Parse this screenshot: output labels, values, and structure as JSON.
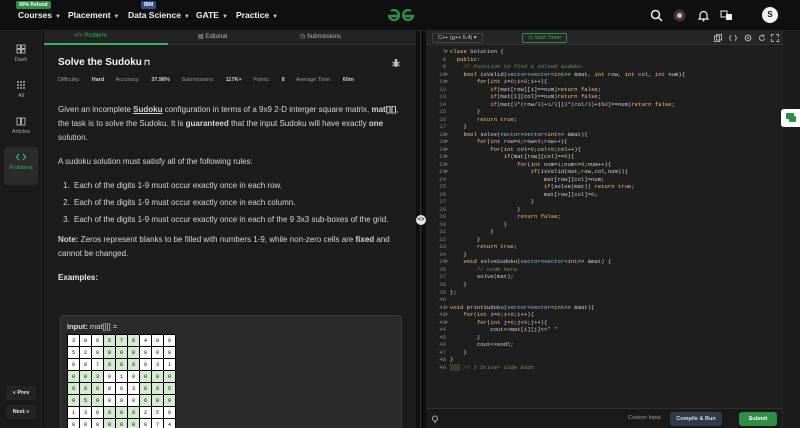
{
  "topbar": {
    "refund_badge": "90% Refund",
    "ibm_badge": "IBM",
    "nav": [
      "Courses",
      "Placement",
      "Data Science",
      "GATE",
      "Practice"
    ],
    "avatar_initial": "S",
    "brand_color": "#2f8d46"
  },
  "leftnav": {
    "items": [
      "Dash",
      "All",
      "Articles",
      "Problems"
    ],
    "prev": "« Prev",
    "next": "Next »"
  },
  "problem": {
    "tabs": [
      "Problem",
      "Editorial",
      "Submissions"
    ],
    "title": "Solve the Sudoku",
    "meta": {
      "difficulty_label": "Difficulty:",
      "difficulty": "Hard",
      "accuracy_label": "Accuracy:",
      "accuracy": "37.98%",
      "submissions_label": "Submissions:",
      "submissions": "117K+",
      "points_label": "Points:",
      "points": "8",
      "time_label": "Average Time:",
      "time": "60m"
    },
    "para1_a": "Given an incomplete ",
    "para1_link": "Sudoku",
    "para1_b": " configuration in terms of a 9x9  2-D interger square matrix, ",
    "para1_mat": "mat[][]",
    "para1_c": ", the task is to solve the Sudoku. It is ",
    "para1_guaranteed": "guaranteed",
    "para1_d": " that the input Sudoku will have exactly ",
    "para1_one": "one",
    "para1_e": " solution.",
    "para2": "A sudoku solution must satisfy all of the following rules:",
    "rules": [
      "Each of the digits 1-9 must occur exactly once in each row.",
      "Each of the digits 1-9 must occur exactly once in each column.",
      "Each of the digits 1-9 must occur exactly once in each of the 9 3x3 sub-boxes of the grid."
    ],
    "note_label": "Note:",
    "note_a": " Zeros represent blanks to be filled with numbers 1-9, while non-zero cells are ",
    "note_fixed": "fixed",
    "note_b": " and cannot be changed.",
    "examples": "Examples:",
    "input_label": "Input:",
    "input_var": "mat[][] =",
    "grid": [
      [
        "3",
        "0",
        "6",
        "5",
        "7",
        "8",
        "4",
        "0",
        "0"
      ],
      [
        "5",
        "2",
        "0",
        "0",
        "0",
        "0",
        "0",
        "0",
        "0"
      ],
      [
        "0",
        "8",
        "7",
        "0",
        "0",
        "0",
        "0",
        "3",
        "1"
      ],
      [
        "0",
        "0",
        "3",
        "0",
        "1",
        "0",
        "0",
        "8",
        "0"
      ],
      [
        "9",
        "0",
        "0",
        "8",
        "6",
        "3",
        "0",
        "0",
        "5"
      ],
      [
        "0",
        "5",
        "0",
        "0",
        "9",
        "0",
        "6",
        "0",
        "0"
      ],
      [
        "1",
        "3",
        "0",
        "0",
        "0",
        "0",
        "2",
        "5",
        "0"
      ],
      [
        "0",
        "0",
        "0",
        "0",
        "0",
        "0",
        "0",
        "7",
        "4"
      ]
    ]
  },
  "editor": {
    "language": "C++ (g++ 5.4)",
    "timer": "Start Timer",
    "custom_input": "Custom Input",
    "compile": "Compile & Run",
    "submit": "Submit",
    "lines": [
      {
        "n": "7",
        "fold": "▾",
        "t": [
          [
            "kw",
            "class "
          ],
          [
            "",
            "Solution {"
          ]
        ]
      },
      {
        "n": "8",
        "fold": "",
        "t": [
          [
            "kw",
            "  public:"
          ]
        ]
      },
      {
        "n": "9",
        "fold": "",
        "t": [
          [
            "cm",
            "    // Function to find a solved Sudoku."
          ]
        ]
      },
      {
        "n": "10",
        "fold": "▾",
        "t": [
          [
            "",
            "    "
          ],
          [
            "kw",
            "bool "
          ],
          [
            "",
            "isValid("
          ],
          [
            "ty",
            "vector"
          ],
          [
            "",
            "<"
          ],
          [
            "ty",
            "vector"
          ],
          [
            "",
            "<"
          ],
          [
            "kw",
            "int"
          ],
          [
            "",
            ">> &mat, "
          ],
          [
            "kw",
            "int "
          ],
          [
            "",
            "row, "
          ],
          [
            "kw",
            "int "
          ],
          [
            "",
            "col, "
          ],
          [
            "kw",
            "int "
          ],
          [
            "",
            "num){"
          ]
        ]
      },
      {
        "n": "11",
        "fold": "▾",
        "t": [
          [
            "",
            "        "
          ],
          [
            "kw",
            "for"
          ],
          [
            "",
            "("
          ],
          [
            "kw",
            "int "
          ],
          [
            "",
            "i="
          ],
          [
            "nm",
            "0"
          ],
          [
            "",
            ";i<"
          ],
          [
            "nm",
            "9"
          ],
          [
            "",
            ";i++){"
          ]
        ]
      },
      {
        "n": "12",
        "fold": "",
        "t": [
          [
            "",
            "            "
          ],
          [
            "kw",
            "if"
          ],
          [
            "",
            "(mat[row][i]==num)"
          ],
          [
            "kw",
            "return false"
          ],
          [
            "",
            ";"
          ]
        ]
      },
      {
        "n": "13",
        "fold": "",
        "t": [
          [
            "",
            "            "
          ],
          [
            "kw",
            "if"
          ],
          [
            "",
            "(mat[i][col]==num)"
          ],
          [
            "kw",
            "return false"
          ],
          [
            "",
            ";"
          ]
        ]
      },
      {
        "n": "14",
        "fold": "",
        "t": [
          [
            "",
            "            "
          ],
          [
            "kw",
            "if"
          ],
          [
            "",
            "(mat["
          ],
          [
            "nm",
            "3"
          ],
          [
            "",
            "*(row/"
          ],
          [
            "nm",
            "3"
          ],
          [
            "",
            ")+i/"
          ],
          [
            "nm",
            "3"
          ],
          [
            "",
            "]["
          ],
          [
            "nm",
            "3"
          ],
          [
            "",
            "*(col/"
          ],
          [
            "nm",
            "3"
          ],
          [
            "",
            ")+i%"
          ],
          [
            "nm",
            "3"
          ],
          [
            "",
            "]==num)"
          ],
          [
            "kw",
            "return false"
          ],
          [
            "",
            ";"
          ]
        ]
      },
      {
        "n": "15",
        "fold": "",
        "t": [
          [
            "",
            "        }"
          ]
        ]
      },
      {
        "n": "16",
        "fold": "",
        "t": [
          [
            "",
            "        "
          ],
          [
            "kw",
            "return true"
          ],
          [
            "",
            ";"
          ]
        ]
      },
      {
        "n": "17",
        "fold": "",
        "t": [
          [
            "",
            "    }"
          ]
        ]
      },
      {
        "n": "18",
        "fold": "▾",
        "t": [
          [
            "",
            "    "
          ],
          [
            "kw",
            "bool "
          ],
          [
            "",
            "solve("
          ],
          [
            "ty",
            "vector"
          ],
          [
            "",
            "<"
          ],
          [
            "ty",
            "vector"
          ],
          [
            "",
            "<"
          ],
          [
            "kw",
            "int"
          ],
          [
            "",
            ">> &mat){"
          ]
        ]
      },
      {
        "n": "19",
        "fold": "▾",
        "t": [
          [
            "",
            "        "
          ],
          [
            "kw",
            "for"
          ],
          [
            "",
            "("
          ],
          [
            "kw",
            "int "
          ],
          [
            "",
            "row="
          ],
          [
            "nm",
            "0"
          ],
          [
            "",
            ";row<"
          ],
          [
            "nm",
            "9"
          ],
          [
            "",
            ";row++){"
          ]
        ]
      },
      {
        "n": "20",
        "fold": "▾",
        "t": [
          [
            "",
            "            "
          ],
          [
            "kw",
            "for"
          ],
          [
            "",
            "("
          ],
          [
            "kw",
            "int "
          ],
          [
            "",
            "col="
          ],
          [
            "nm",
            "0"
          ],
          [
            "",
            ";col<"
          ],
          [
            "nm",
            "9"
          ],
          [
            "",
            ";col++){"
          ]
        ]
      },
      {
        "n": "21",
        "fold": "▾",
        "t": [
          [
            "",
            "                "
          ],
          [
            "kw",
            "if"
          ],
          [
            "",
            "(mat[row][col]=="
          ],
          [
            "nm",
            "0"
          ],
          [
            "",
            "){"
          ]
        ]
      },
      {
        "n": "22",
        "fold": "▾",
        "t": [
          [
            "",
            "                    "
          ],
          [
            "kw",
            "for"
          ],
          [
            "",
            "("
          ],
          [
            "kw",
            "int "
          ],
          [
            "",
            "num="
          ],
          [
            "nm",
            "1"
          ],
          [
            "",
            ";num<="
          ],
          [
            "nm",
            "9"
          ],
          [
            "",
            ";num++){"
          ]
        ]
      },
      {
        "n": "23",
        "fold": "▾",
        "t": [
          [
            "",
            "                        "
          ],
          [
            "kw",
            "if"
          ],
          [
            "",
            "(isValid(mat,row,col,num)){"
          ]
        ]
      },
      {
        "n": "24",
        "fold": "",
        "t": [
          [
            "",
            "                            mat[row][col]=num;"
          ]
        ]
      },
      {
        "n": "25",
        "fold": "",
        "t": [
          [
            "",
            "                            "
          ],
          [
            "kw",
            "if"
          ],
          [
            "",
            "(solve(mat)) "
          ],
          [
            "kw",
            "return true"
          ],
          [
            "",
            ";"
          ]
        ]
      },
      {
        "n": "26",
        "fold": "",
        "t": [
          [
            "",
            "                            mat[row][col]="
          ],
          [
            "nm",
            "0"
          ],
          [
            "",
            ";"
          ]
        ]
      },
      {
        "n": "27",
        "fold": "",
        "t": [
          [
            "",
            "                        }"
          ]
        ]
      },
      {
        "n": "28",
        "fold": "",
        "t": [
          [
            "",
            "                    }"
          ]
        ]
      },
      {
        "n": "29",
        "fold": "",
        "t": [
          [
            "",
            "                    "
          ],
          [
            "kw",
            "return false"
          ],
          [
            "",
            ";"
          ]
        ]
      },
      {
        "n": "30",
        "fold": "",
        "t": [
          [
            "",
            "                }"
          ]
        ]
      },
      {
        "n": "31",
        "fold": "",
        "t": [
          [
            "",
            "            }"
          ]
        ]
      },
      {
        "n": "32",
        "fold": "",
        "t": [
          [
            "",
            "        }"
          ]
        ]
      },
      {
        "n": "33",
        "fold": "",
        "t": [
          [
            "",
            "        "
          ],
          [
            "kw",
            "return true"
          ],
          [
            "",
            ";"
          ]
        ]
      },
      {
        "n": "34",
        "fold": "",
        "t": [
          [
            "",
            "    }"
          ]
        ]
      },
      {
        "n": "35",
        "fold": "▾",
        "t": [
          [
            "",
            "    "
          ],
          [
            "kw",
            "void "
          ],
          [
            "",
            "solveSudoku("
          ],
          [
            "ty",
            "vector"
          ],
          [
            "",
            "<"
          ],
          [
            "ty",
            "vector"
          ],
          [
            "",
            "<"
          ],
          [
            "kw",
            "int"
          ],
          [
            "",
            ">> &mat) {"
          ]
        ]
      },
      {
        "n": "36",
        "fold": "",
        "t": [
          [
            "cm",
            "        // code here"
          ]
        ]
      },
      {
        "n": "37",
        "fold": "",
        "t": [
          [
            "",
            "        solve(mat);"
          ]
        ]
      },
      {
        "n": "38",
        "fold": "",
        "t": [
          [
            "",
            "    }"
          ]
        ]
      },
      {
        "n": "39",
        "fold": "",
        "t": [
          [
            "",
            "};"
          ]
        ]
      },
      {
        "n": "40",
        "fold": "",
        "t": [
          [
            "",
            ""
          ]
        ]
      },
      {
        "n": "41",
        "fold": "▾",
        "t": [
          [
            "kw",
            "void "
          ],
          [
            "",
            "printSudoku("
          ],
          [
            "ty",
            "vector"
          ],
          [
            "",
            "<"
          ],
          [
            "ty",
            "vector"
          ],
          [
            "",
            "<"
          ],
          [
            "kw",
            "int"
          ],
          [
            "",
            ">> &mat){"
          ]
        ]
      },
      {
        "n": "42",
        "fold": "▾",
        "t": [
          [
            "",
            "    "
          ],
          [
            "kw",
            "for"
          ],
          [
            "",
            "("
          ],
          [
            "kw",
            "int "
          ],
          [
            "",
            "i="
          ],
          [
            "nm",
            "0"
          ],
          [
            "",
            ";i<"
          ],
          [
            "nm",
            "9"
          ],
          [
            "",
            ";i++){"
          ]
        ]
      },
      {
        "n": "43",
        "fold": "▾",
        "t": [
          [
            "",
            "        "
          ],
          [
            "kw",
            "for"
          ],
          [
            "",
            "("
          ],
          [
            "kw",
            "int "
          ],
          [
            "",
            "j="
          ],
          [
            "nm",
            "0"
          ],
          [
            "",
            ";j<"
          ],
          [
            "nm",
            "9"
          ],
          [
            "",
            ";j++){"
          ]
        ]
      },
      {
        "n": "44",
        "fold": "",
        "t": [
          [
            "",
            "            cout<<mat[i][j]<<"
          ],
          [
            "nm",
            "\" \""
          ]
        ]
      },
      {
        "n": "45",
        "fold": "",
        "t": [
          [
            "",
            "        }"
          ]
        ]
      },
      {
        "n": "46",
        "fold": "",
        "t": [
          [
            "",
            "        cout<<endl;"
          ]
        ]
      },
      {
        "n": "47",
        "fold": "",
        "t": [
          [
            "",
            "    }"
          ]
        ]
      },
      {
        "n": "48",
        "fold": "",
        "t": [
          [
            "",
            "}"
          ]
        ]
      },
      {
        "n": "49",
        "fold": "",
        "t": [
          [
            "hl",
            "   "
          ],
          [
            "cm",
            " // } Driver Code Ends"
          ]
        ]
      }
    ]
  }
}
